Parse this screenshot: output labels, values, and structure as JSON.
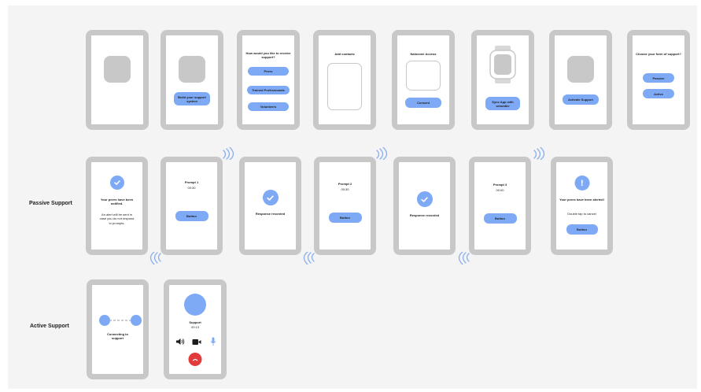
{
  "onboarding": {
    "build_label": "Build your support system",
    "receive": {
      "question": "How would you like to receive support?",
      "options": [
        "Peers",
        "Trained Professionals",
        "Volunteers"
      ]
    },
    "add_contacts_title": "Add contacts",
    "naloxone": {
      "title": "Naloxone Access",
      "button": "Consent"
    },
    "sync_label": "Sync App with wearable",
    "activate_label": "Activate Support",
    "form": {
      "question": "Choose your form of support?",
      "options": [
        "Passive",
        "Active"
      ]
    }
  },
  "passive": {
    "label": "Passive Support",
    "notified": {
      "title": "Your peers have been notified.",
      "body": "An alert will be sent in case you do not respond to prompts."
    },
    "prompts": [
      {
        "title": "Prompt 1",
        "timer": "00:30",
        "button": "Button"
      },
      {
        "title": "Prompt 2",
        "timer": "00:30",
        "button": "Button"
      },
      {
        "title": "Prompt 3",
        "timer": "00:00",
        "button": "Button"
      }
    ],
    "recorded": [
      "Response recorded",
      "Response recorded"
    ],
    "alerted": {
      "title": "Your peers have been alerted!",
      "hint": "Double tap to cancel",
      "button": "Button"
    }
  },
  "active": {
    "label": "Active Support",
    "connecting": "Connecting to support",
    "call": {
      "name": "Support",
      "timer": "00:13"
    }
  },
  "colors": {
    "accent": "#7eaaf5",
    "frame": "#c8c8c8",
    "end_call": "#e23b3b",
    "background": "#f4f4f4"
  },
  "icons": [
    "check-icon",
    "exclamation-icon",
    "speaker-icon",
    "video-icon",
    "microphone-icon",
    "end-call-icon",
    "vibration-icon",
    "watch-icon"
  ]
}
